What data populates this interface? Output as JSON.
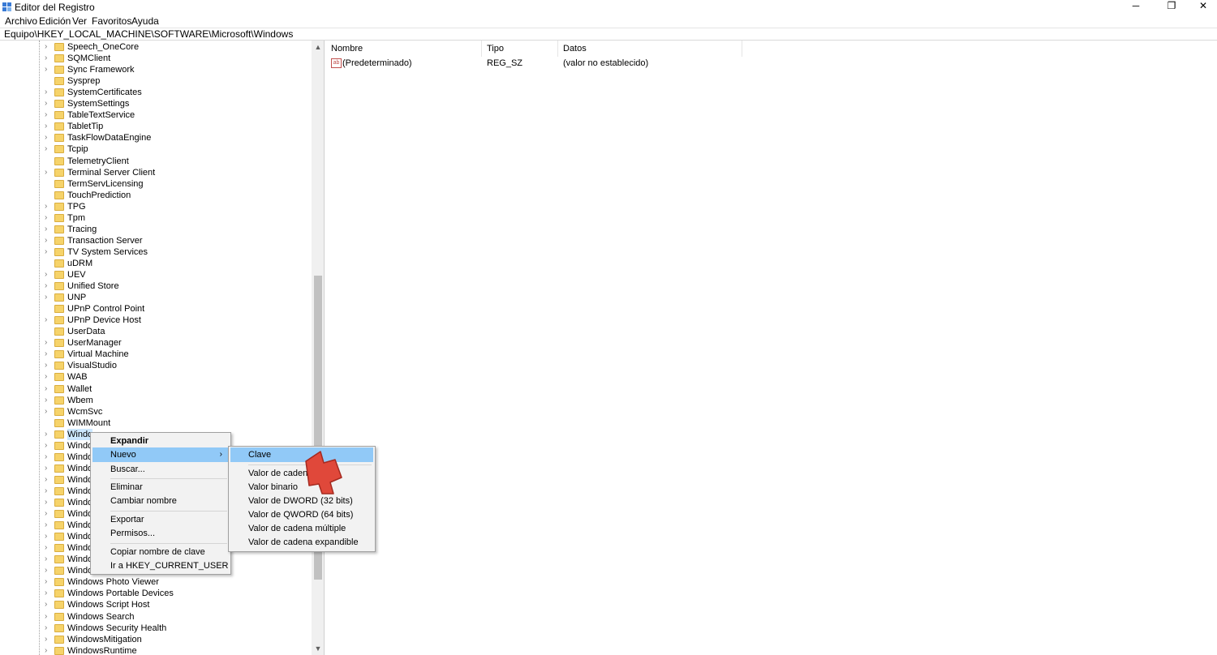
{
  "window": {
    "title": "Editor del Registro",
    "controls": {
      "minimize": "─",
      "maximize": "❐",
      "close": "✕"
    }
  },
  "menubar": {
    "items": [
      "Archivo",
      "Edición",
      "Ver",
      "Favoritos",
      "Ayuda"
    ]
  },
  "address": "Equipo\\HKEY_LOCAL_MACHINE\\SOFTWARE\\Microsoft\\Windows",
  "tree": {
    "items": [
      {
        "label": "Speech_OneCore",
        "arrow": true
      },
      {
        "label": "SQMClient",
        "arrow": true
      },
      {
        "label": "Sync Framework",
        "arrow": true
      },
      {
        "label": "Sysprep",
        "arrow": false
      },
      {
        "label": "SystemCertificates",
        "arrow": true
      },
      {
        "label": "SystemSettings",
        "arrow": true
      },
      {
        "label": "TableTextService",
        "arrow": true
      },
      {
        "label": "TabletTip",
        "arrow": true
      },
      {
        "label": "TaskFlowDataEngine",
        "arrow": true
      },
      {
        "label": "Tcpip",
        "arrow": true
      },
      {
        "label": "TelemetryClient",
        "arrow": false
      },
      {
        "label": "Terminal Server Client",
        "arrow": true
      },
      {
        "label": "TermServLicensing",
        "arrow": false
      },
      {
        "label": "TouchPrediction",
        "arrow": false
      },
      {
        "label": "TPG",
        "arrow": true
      },
      {
        "label": "Tpm",
        "arrow": true
      },
      {
        "label": "Tracing",
        "arrow": true
      },
      {
        "label": "Transaction Server",
        "arrow": true
      },
      {
        "label": "TV System Services",
        "arrow": true
      },
      {
        "label": "uDRM",
        "arrow": false
      },
      {
        "label": "UEV",
        "arrow": true
      },
      {
        "label": "Unified Store",
        "arrow": true
      },
      {
        "label": "UNP",
        "arrow": true
      },
      {
        "label": "UPnP Control Point",
        "arrow": false
      },
      {
        "label": "UPnP Device Host",
        "arrow": true
      },
      {
        "label": "UserData",
        "arrow": false
      },
      {
        "label": "UserManager",
        "arrow": true
      },
      {
        "label": "Virtual Machine",
        "arrow": true
      },
      {
        "label": "VisualStudio",
        "arrow": true
      },
      {
        "label": "WAB",
        "arrow": true
      },
      {
        "label": "Wallet",
        "arrow": true
      },
      {
        "label": "Wbem",
        "arrow": true
      },
      {
        "label": "WcmSvc",
        "arrow": true
      },
      {
        "label": "WIMMount",
        "arrow": false
      },
      {
        "label": "Windo",
        "arrow": true,
        "selected": true
      },
      {
        "label": "Windo",
        "arrow": true
      },
      {
        "label": "Windo",
        "arrow": true
      },
      {
        "label": "Windo",
        "arrow": true
      },
      {
        "label": "Windo",
        "arrow": true
      },
      {
        "label": "Windo",
        "arrow": true
      },
      {
        "label": "Windo",
        "arrow": true
      },
      {
        "label": "Windo",
        "arrow": true
      },
      {
        "label": "Windo",
        "arrow": true
      },
      {
        "label": "Windo",
        "arrow": true
      },
      {
        "label": "Windo",
        "arrow": true
      },
      {
        "label": "Windo",
        "arrow": true
      },
      {
        "label": "Windo",
        "arrow": true
      },
      {
        "label": "Windows Photo Viewer",
        "arrow": true
      },
      {
        "label": "Windows Portable Devices",
        "arrow": true
      },
      {
        "label": "Windows Script Host",
        "arrow": true
      },
      {
        "label": "Windows Search",
        "arrow": true
      },
      {
        "label": "Windows Security Health",
        "arrow": true
      },
      {
        "label": "WindowsMitigation",
        "arrow": true
      },
      {
        "label": "WindowsRuntime",
        "arrow": true
      }
    ]
  },
  "values": {
    "columns": [
      "Nombre",
      "Tipo",
      "Datos"
    ],
    "rows": [
      {
        "name": "(Predeterminado)",
        "type": "REG_SZ",
        "data": "(valor no establecido)",
        "icon": "ab"
      }
    ]
  },
  "context_menu": {
    "items": [
      "Expandir",
      "Nuevo",
      "Buscar...",
      "Eliminar",
      "Cambiar nombre",
      "Exportar",
      "Permisos...",
      "Copiar nombre de clave",
      "Ir a HKEY_CURRENT_USER"
    ],
    "submenu_arrow": "›"
  },
  "submenu": {
    "items": [
      "Clave",
      "Valor de cadena",
      "Valor binario",
      "Valor de DWORD (32 bits)",
      "Valor de QWORD (64 bits)",
      "Valor de cadena múltiple",
      "Valor de cadena expandible"
    ]
  },
  "scroll": {
    "up": "▲",
    "down": "▼"
  },
  "colors": {
    "highlight": "#91c9f7",
    "selection": "#cce8ff",
    "folder": "#f6d36a",
    "pointer_arrow": "#e0483a"
  }
}
